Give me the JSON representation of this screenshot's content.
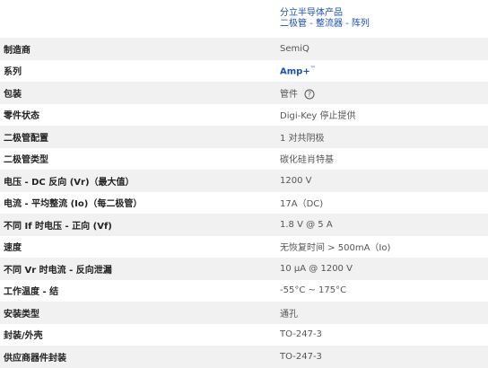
{
  "category": {
    "line1": "分立半导体产品",
    "line2": "二极管 - 整流器 - 阵列"
  },
  "rows": [
    {
      "label": "制造商",
      "value": "SemiQ"
    },
    {
      "label": "系列",
      "value": "Amp+",
      "value_suffix": "™"
    },
    {
      "label": "包装",
      "value": "管件"
    },
    {
      "label": "零件状态",
      "value": "Digi-Key 停止提供"
    },
    {
      "label": "二极管配置",
      "value": "1 对共阴极"
    },
    {
      "label": "二极管类型",
      "value": "碳化硅肖特基"
    },
    {
      "label": "电压 - DC 反向 (Vr)（最大值）",
      "value": "1200 V"
    },
    {
      "label": "电流 - 平均整流 (Io)（每二极管）",
      "value": "17A（DC)"
    },
    {
      "label": "不同 If 时电压 - 正向 (Vf)",
      "value": "1.8 V @ 5 A"
    },
    {
      "label": "速度",
      "value": "无恢复时间 > 500mA（Io)"
    },
    {
      "label": "不同 Vr 时电流 - 反向泄漏",
      "value": "10 µA @ 1200 V"
    },
    {
      "label": "工作温度 - 结",
      "value": "-55°C ~ 175°C"
    },
    {
      "label": "安装类型",
      "value": "通孔"
    },
    {
      "label": "封装/外壳",
      "value": "TO-247-3"
    },
    {
      "label": "供应商器件封装",
      "value": "TO-247-3"
    }
  ],
  "icons": {
    "help": "question-circle-icon"
  },
  "colors": {
    "link": "#1a4fb5",
    "row_shade": "#f1f1f1"
  }
}
